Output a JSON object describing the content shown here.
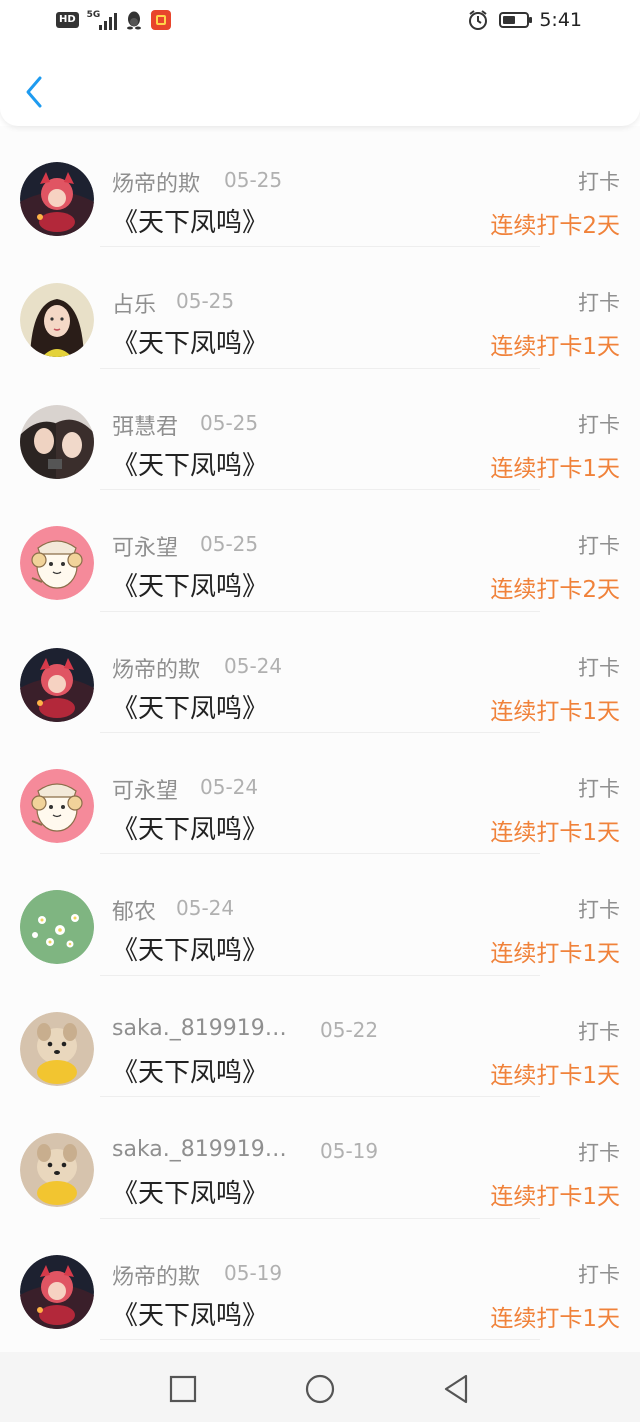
{
  "status_bar": {
    "hd_label": "HD",
    "network_label": "5G",
    "time": "5:41",
    "icons": [
      "signal-icon",
      "qq-icon",
      "app-icon",
      "alarm-icon",
      "battery-icon"
    ]
  },
  "nav": {
    "back_icon": "chevron-left-icon"
  },
  "colors": {
    "streak": "#f0823a",
    "name": "#8f8f8f",
    "date": "#b0b0b0",
    "book": "#222222"
  },
  "records": [
    {
      "name": "炀帝的欺",
      "date": "05-25",
      "book": "《天下凤鸣》",
      "action": "打卡",
      "streak": "连续打卡2天"
    },
    {
      "name": "占乐",
      "date": "05-25",
      "book": "《天下凤鸣》",
      "action": "打卡",
      "streak": "连续打卡1天"
    },
    {
      "name": "弭慧君",
      "date": "05-25",
      "book": "《天下凤鸣》",
      "action": "打卡",
      "streak": "连续打卡1天"
    },
    {
      "name": "可永望",
      "date": "05-25",
      "book": "《天下凤鸣》",
      "action": "打卡",
      "streak": "连续打卡2天"
    },
    {
      "name": "炀帝的欺",
      "date": "05-24",
      "book": "《天下凤鸣》",
      "action": "打卡",
      "streak": "连续打卡1天"
    },
    {
      "name": "可永望",
      "date": "05-24",
      "book": "《天下凤鸣》",
      "action": "打卡",
      "streak": "连续打卡1天"
    },
    {
      "name": "郁农",
      "date": "05-24",
      "book": "《天下凤鸣》",
      "action": "打卡",
      "streak": "连续打卡1天"
    },
    {
      "name": "saka._8199198...",
      "date": "05-22",
      "book": "《天下凤鸣》",
      "action": "打卡",
      "streak": "连续打卡1天"
    },
    {
      "name": "saka._8199198...",
      "date": "05-19",
      "book": "《天下凤鸣》",
      "action": "打卡",
      "streak": "连续打卡1天"
    },
    {
      "name": "炀帝的欺",
      "date": "05-19",
      "book": "《天下凤鸣》",
      "action": "打卡",
      "streak": "连续打卡1天"
    }
  ],
  "bottom_nav": {
    "icons": [
      "recents-square-icon",
      "home-circle-icon",
      "back-triangle-icon"
    ]
  }
}
